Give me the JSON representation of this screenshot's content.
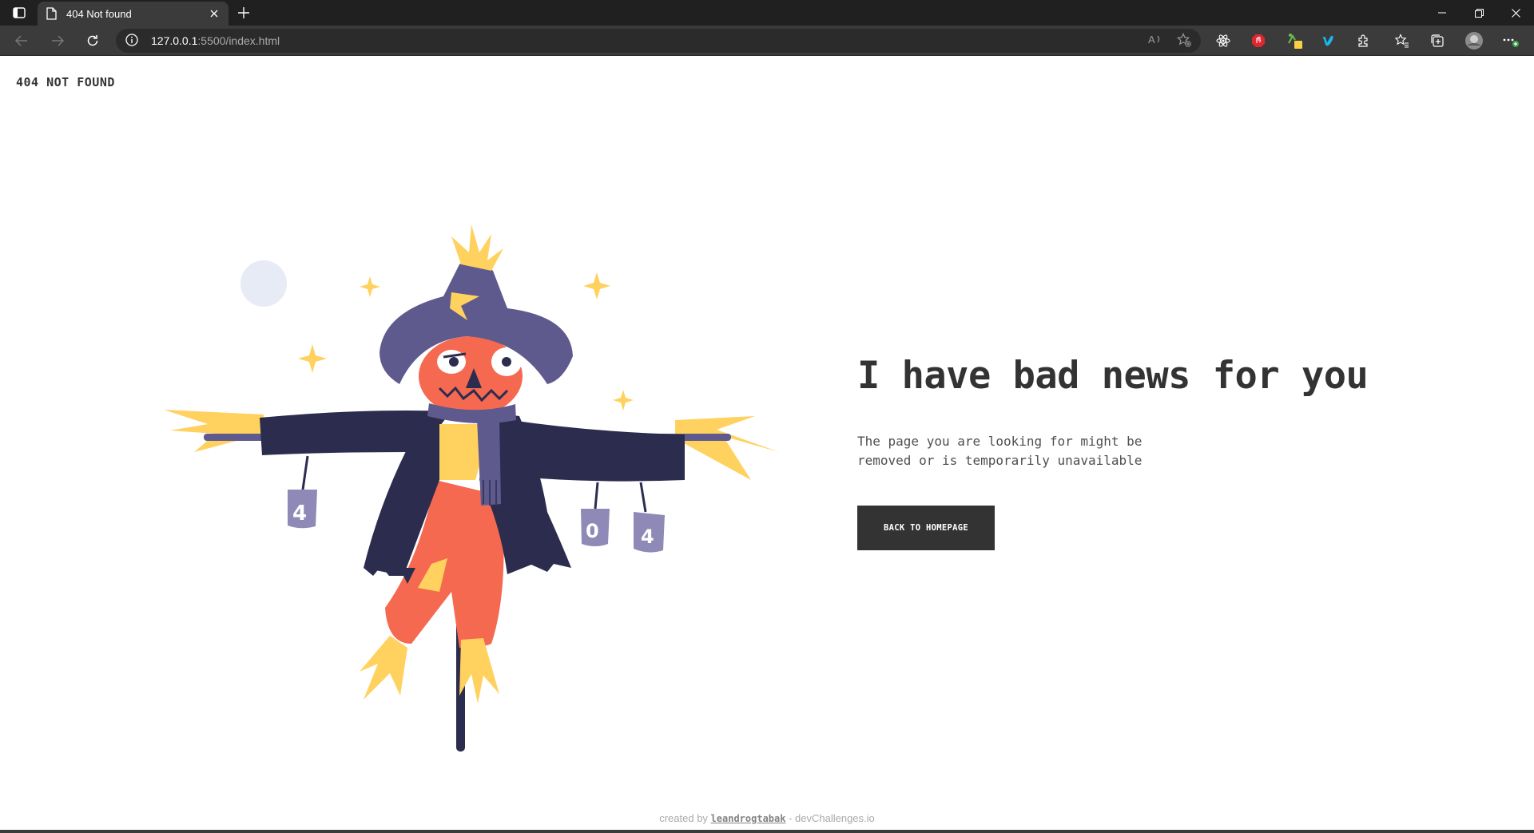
{
  "browser": {
    "tab_title": "404 Not found",
    "url_host": "127.0.0.1",
    "url_rest": ":5500/index.html"
  },
  "page": {
    "brand": "404 NOT FOUND",
    "headline": "I have bad news for you",
    "subtext": "The page you are looking for might be removed or is temporarily unavailable",
    "cta_label": "BACK TO HOMEPAGE",
    "footer_prefix": "created by ",
    "footer_author": "leandrogtabak",
    "footer_suffix": " - devChallenges.io"
  },
  "illustration": {
    "can_labels": [
      "4",
      "0",
      "4"
    ]
  },
  "colors": {
    "dark": "#333333",
    "scarecrow_coat": "#2c2c4f",
    "scarecrow_hat": "#5f5a8d",
    "scarecrow_pants": "#f4694f",
    "straw": "#ffd15f",
    "moon": "#e7ebf5"
  }
}
